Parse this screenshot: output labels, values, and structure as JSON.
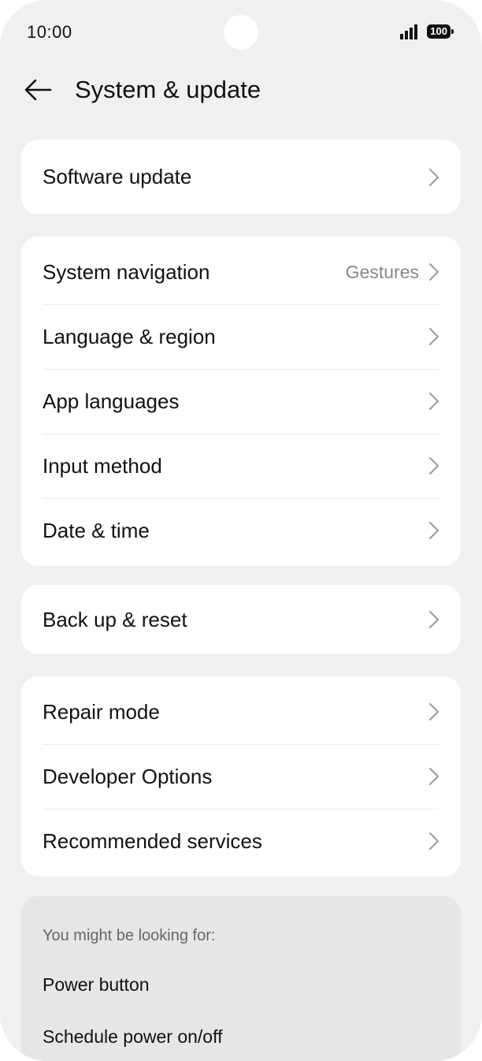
{
  "status": {
    "time": "10:00",
    "battery": "100"
  },
  "header": {
    "title": "System & update"
  },
  "groups": [
    {
      "items": [
        {
          "label": "Software update"
        }
      ]
    },
    {
      "items": [
        {
          "label": "System navigation",
          "value": "Gestures"
        },
        {
          "label": "Language & region"
        },
        {
          "label": "App languages"
        },
        {
          "label": "Input method"
        },
        {
          "label": "Date & time"
        }
      ]
    },
    {
      "items": [
        {
          "label": "Back up & reset"
        }
      ]
    },
    {
      "items": [
        {
          "label": "Repair mode"
        },
        {
          "label": "Developer Options"
        },
        {
          "label": "Recommended services"
        }
      ]
    }
  ],
  "suggestions": {
    "header": "You might be looking for:",
    "items": [
      "Power button",
      "Schedule power on/off"
    ]
  },
  "icons": {
    "back": "arrow-left-icon",
    "chevron": "chevron-right-icon",
    "signal": "signal-bars-icon",
    "battery": "battery-icon"
  }
}
